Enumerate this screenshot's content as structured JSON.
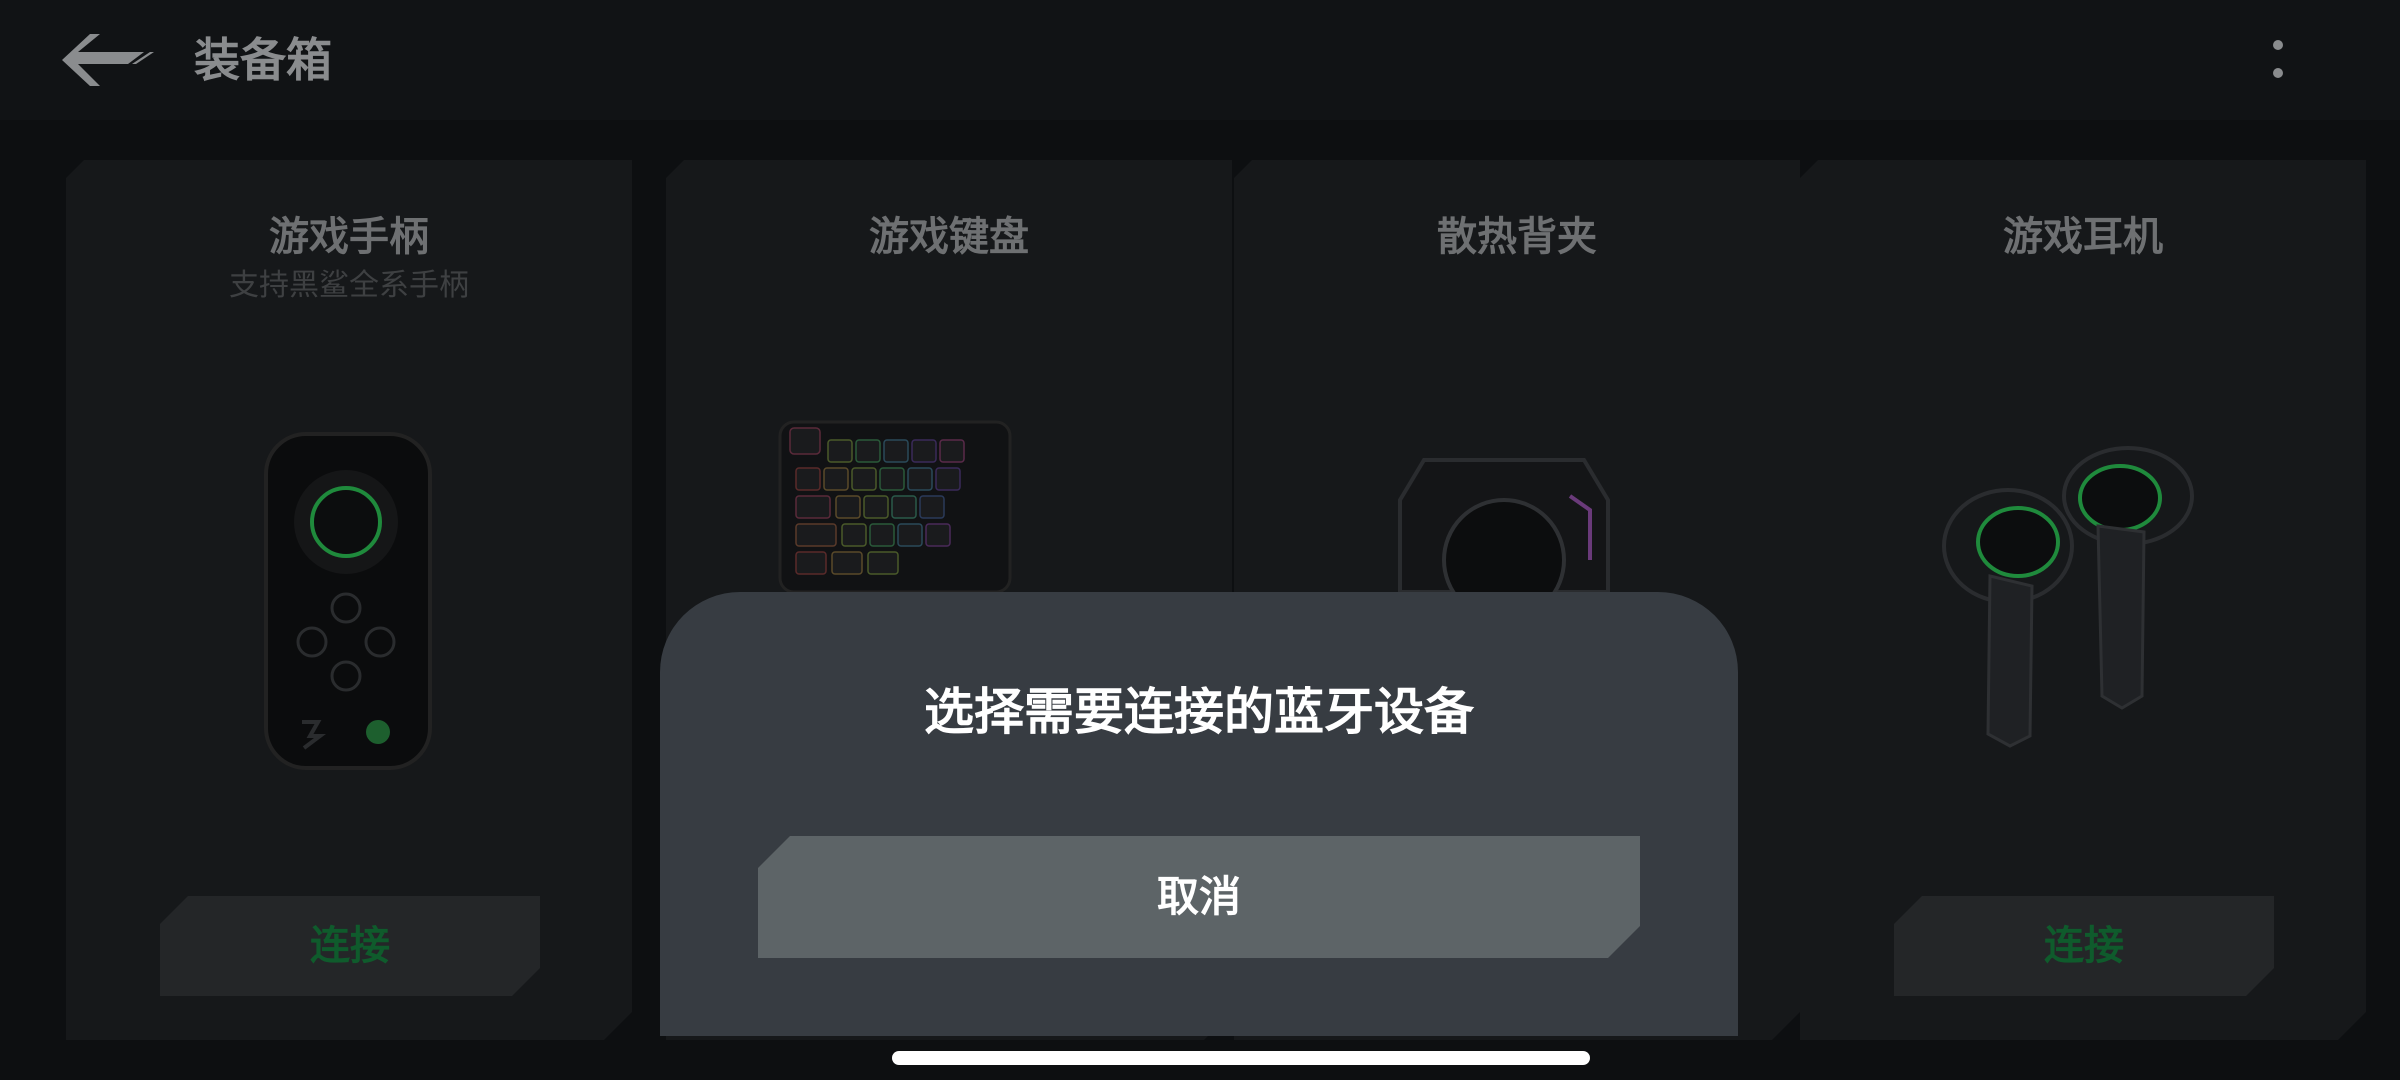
{
  "header": {
    "title": "装备箱",
    "back_icon": "back-arrow-icon",
    "more_icon": "more-vert-icon"
  },
  "cards": [
    {
      "title": "游戏手柄",
      "subtitle": "支持黑鲨全系手柄",
      "button": "连接",
      "device_icon": "gamepad-icon"
    },
    {
      "title": "游戏键盘",
      "device_icon": "keyboard-icon"
    },
    {
      "title": "散热背夹",
      "device_icon": "cooler-icon"
    },
    {
      "title": "游戏耳机",
      "button": "连接",
      "device_icon": "earbuds-icon"
    }
  ],
  "dialog": {
    "title": "选择需要连接的蓝牙设备",
    "cancel_label": "取消"
  },
  "colors": {
    "accent_green": "#0f5b2c",
    "dialog_bg": "#373c42",
    "cancel_bg": "#5d6467"
  }
}
